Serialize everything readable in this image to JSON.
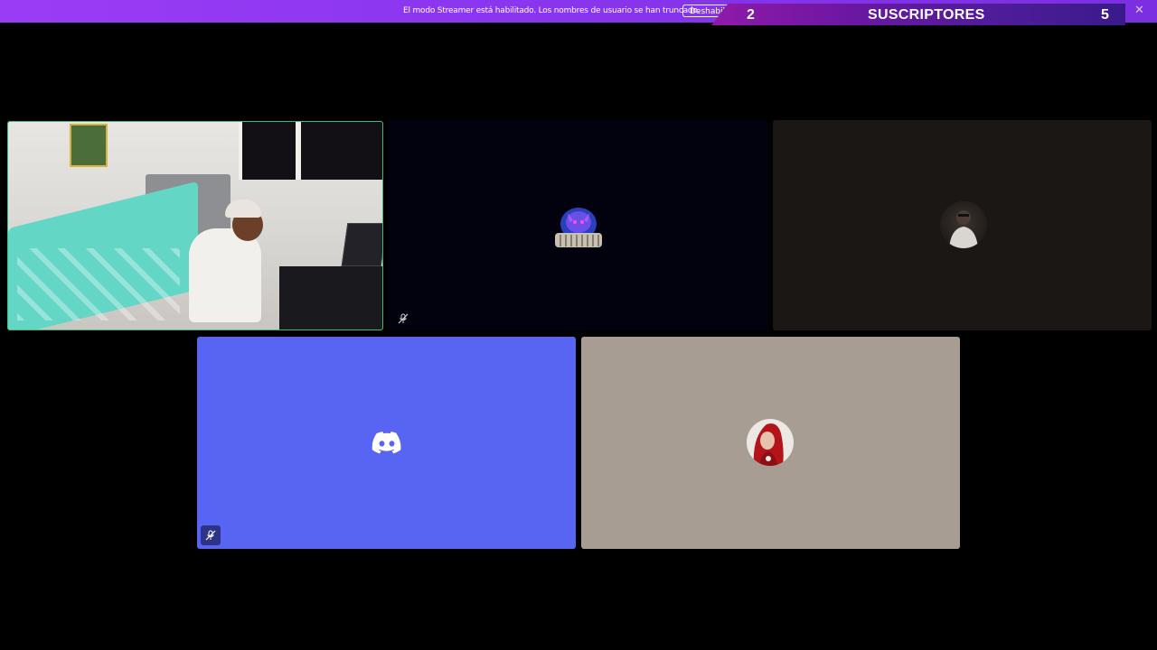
{
  "streamer_mode": {
    "message": "El modo Streamer está habilitado. Los nombres de usuario se han truncado.",
    "button_label": "Deshabili",
    "close_icon": "close-icon"
  },
  "subscriber_overlay": {
    "left_count": "2",
    "title": "SUSCRIPTORES",
    "right_count": "5"
  },
  "tiles": [
    {
      "kind": "video",
      "speaking": true,
      "border_color": "#43b581"
    },
    {
      "kind": "avatar",
      "avatar": "dragon-colosseum-avatar",
      "muted": true,
      "background": "#02020f"
    },
    {
      "kind": "avatar",
      "avatar": "man-portrait-avatar",
      "background": "#1b1715"
    },
    {
      "kind": "avatar",
      "avatar": "discord-default-avatar",
      "muted": true,
      "background": "#5865f2"
    },
    {
      "kind": "avatar",
      "avatar": "red-hood-avatar",
      "background": "#a89d93"
    }
  ],
  "colors": {
    "streamer_bar": "#9b3cf5",
    "discord_blurple": "#5865f2",
    "speaking_green": "#43b581"
  },
  "icons": [
    "mic-muted-icon",
    "discord-logo-icon",
    "close-icon"
  ]
}
